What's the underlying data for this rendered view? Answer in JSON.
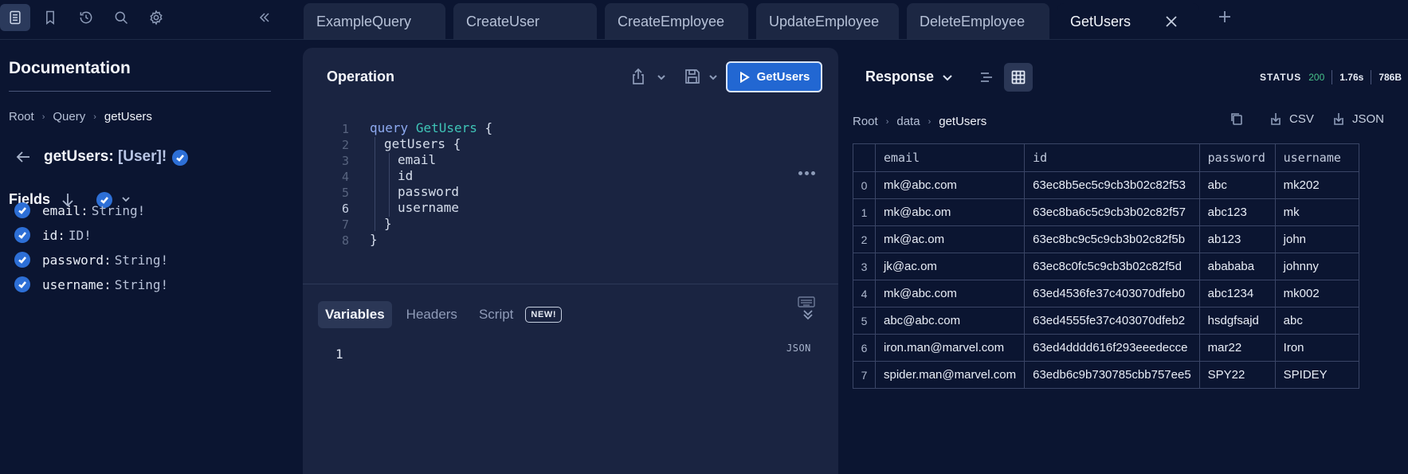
{
  "tabs": [
    {
      "label": "ExampleQuery"
    },
    {
      "label": "CreateUser"
    },
    {
      "label": "CreateEmployee"
    },
    {
      "label": "UpdateEmployee"
    },
    {
      "label": "DeleteEmployee"
    },
    {
      "label": "GetUsers",
      "active": true
    }
  ],
  "docs": {
    "title": "Documentation",
    "breadcrumb": [
      "Root",
      "Query",
      "getUsers"
    ],
    "query_name": "getUsers:",
    "query_type": "[User]!",
    "fields_heading": "Fields",
    "fields": [
      {
        "name": "email:",
        "type": "String!"
      },
      {
        "name": "id:",
        "type": "ID!"
      },
      {
        "name": "password:",
        "type": "String!"
      },
      {
        "name": "username:",
        "type": "String!"
      }
    ]
  },
  "operation": {
    "title": "Operation",
    "run_label": "GetUsers",
    "lines": [
      "1",
      "2",
      "3",
      "4",
      "5",
      "6",
      "7",
      "8"
    ],
    "code": {
      "kw": "query",
      "op_name": "GetUsers",
      "open": "{",
      "field": "getUsers",
      "inner_open": "{",
      "subfields": [
        "email",
        "id",
        "password",
        "username"
      ],
      "inner_close": "}",
      "close": "}"
    },
    "var_tabs": [
      "Variables",
      "Headers",
      "Script"
    ],
    "new_badge": "NEW!",
    "var_line": "1",
    "json_label": "JSON"
  },
  "response": {
    "title": "Response",
    "status_label": "STATUS",
    "status_code": "200",
    "time": "1.76s",
    "size": "786B",
    "breadcrumb": [
      "Root",
      "data",
      "getUsers"
    ],
    "csv_label": "CSV",
    "json_label": "JSON",
    "columns": [
      "email",
      "id",
      "password",
      "username"
    ],
    "rows": [
      {
        "idx": "0",
        "email": "mk@abc.com",
        "id": "63ec8b5ec5c9cb3b02c82f53",
        "password": "abc",
        "username": "mk202"
      },
      {
        "idx": "1",
        "email": "mk@abc.om",
        "id": "63ec8ba6c5c9cb3b02c82f57",
        "password": "abc123",
        "username": "mk"
      },
      {
        "idx": "2",
        "email": "mk@ac.om",
        "id": "63ec8bc9c5c9cb3b02c82f5b",
        "password": "ab123",
        "username": "john"
      },
      {
        "idx": "3",
        "email": "jk@ac.om",
        "id": "63ec8c0fc5c9cb3b02c82f5d",
        "password": "abababa",
        "username": "johnny"
      },
      {
        "idx": "4",
        "email": "mk@abc.com",
        "id": "63ed4536fe37c403070dfeb0",
        "password": "abc1234",
        "username": "mk002"
      },
      {
        "idx": "5",
        "email": "abc@abc.com",
        "id": "63ed4555fe37c403070dfeb2",
        "password": "hsdgfsajd",
        "username": "abc"
      },
      {
        "idx": "6",
        "email": "iron.man@marvel.com",
        "id": "63ed4dddd616f293eeedecce",
        "password": "mar22",
        "username": "Iron"
      },
      {
        "idx": "7",
        "email": "spider.man@marvel.com",
        "id": "63edb6c9b730785cbb757ee5",
        "password": "SPY22",
        "username": "SPIDEY"
      }
    ]
  },
  "colors": {
    "background": "#0b1531",
    "panel": "#1a2441",
    "accent": "#2267d2",
    "status_ok": "#47c38a",
    "keyword": "#8eaaf0",
    "op_name": "#3fc5b7"
  }
}
